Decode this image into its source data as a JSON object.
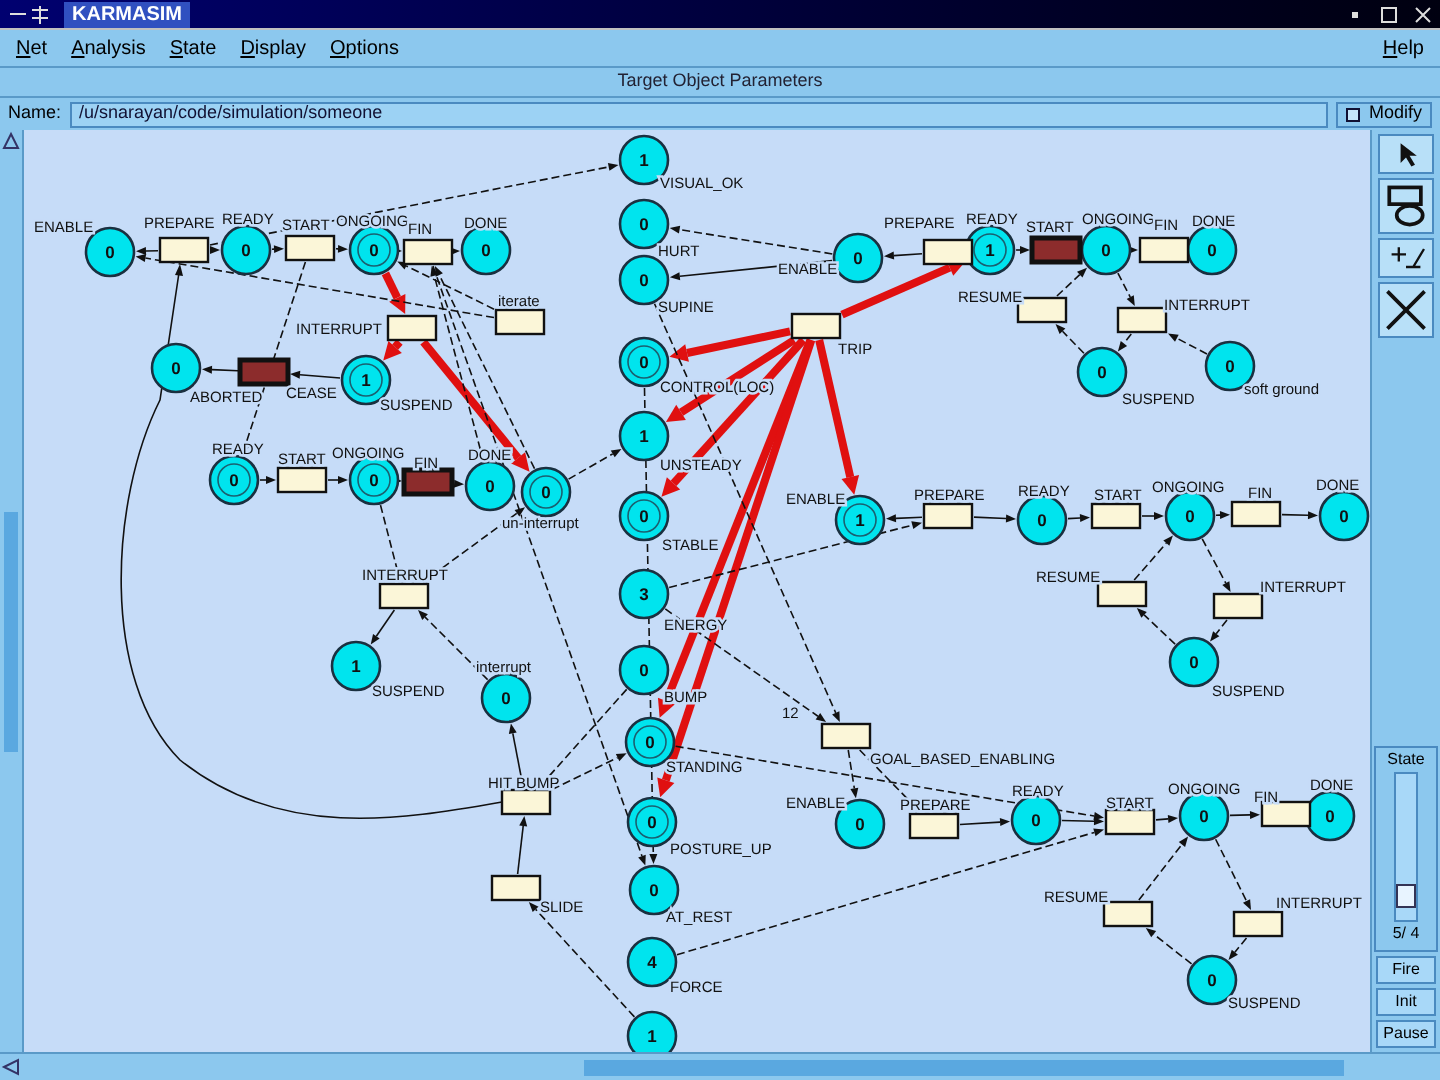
{
  "window": {
    "title": "KARMASIM"
  },
  "menu": [
    "Net",
    "Analysis",
    "State",
    "Display",
    "Options"
  ],
  "help_menu": "Help",
  "section_title": "Target Object Parameters",
  "name_field": {
    "label": "Name:",
    "value": "/u/snarayan/code/simulation/someone"
  },
  "modify": {
    "label": "Modify",
    "checked": false
  },
  "places": [
    {
      "label": "ENABLE",
      "tokens": "0",
      "marked": false
    },
    {
      "label": "READY",
      "tokens": "0",
      "marked": false
    },
    {
      "label": "ONGOING",
      "tokens": "0",
      "marked": true
    },
    {
      "label": "DONE",
      "tokens": "0",
      "marked": false
    },
    {
      "label": "ABORTED",
      "tokens": "0",
      "marked": false
    },
    {
      "label": "SUSPEND",
      "tokens": "1",
      "marked": true
    },
    {
      "label": "READY",
      "tokens": "0",
      "marked": true
    },
    {
      "label": "ONGOING",
      "tokens": "0",
      "marked": true
    },
    {
      "label": "DONE",
      "tokens": "0",
      "marked": false
    },
    {
      "label": "un-interrupt",
      "tokens": "0",
      "marked": true
    },
    {
      "label": "SUSPEND",
      "tokens": "1",
      "marked": false
    },
    {
      "label": "interrupt",
      "tokens": "0",
      "marked": false
    },
    {
      "label": "VISUAL_OK",
      "tokens": "1",
      "marked": false
    },
    {
      "label": "HURT",
      "tokens": "0",
      "marked": false
    },
    {
      "label": "SUPINE",
      "tokens": "0",
      "marked": false
    },
    {
      "label": "CONTROL(LOC)",
      "tokens": "0",
      "marked": true
    },
    {
      "label": "UNSTEADY",
      "tokens": "1",
      "marked": false
    },
    {
      "label": "STABLE",
      "tokens": "0",
      "marked": true
    },
    {
      "label": "ENERGY",
      "tokens": "3",
      "marked": false
    },
    {
      "label": "BUMP",
      "tokens": "0",
      "marked": false
    },
    {
      "label": "STANDING",
      "tokens": "0",
      "marked": true
    },
    {
      "label": "POSTURE_UP",
      "tokens": "0",
      "marked": true
    },
    {
      "label": "AT_REST",
      "tokens": "0",
      "marked": false
    },
    {
      "label": "FORCE",
      "tokens": "4",
      "marked": false
    },
    {
      "tokens": "1",
      "marked": false
    },
    {
      "label": "ENABLE",
      "tokens": "0",
      "marked": false
    },
    {
      "label": "READY",
      "tokens": "1",
      "marked": true
    },
    {
      "label": "ONGOING",
      "tokens": "0",
      "marked": false
    },
    {
      "label": "DONE",
      "tokens": "0",
      "marked": false
    },
    {
      "label": "SUSPEND",
      "tokens": "0",
      "marked": false
    },
    {
      "label": "soft ground",
      "tokens": "0",
      "marked": false
    },
    {
      "label": "ENABLE",
      "tokens": "1",
      "marked": true
    },
    {
      "label": "READY",
      "tokens": "0",
      "marked": false
    },
    {
      "label": "ONGOING",
      "tokens": "0",
      "marked": false
    },
    {
      "label": "DONE",
      "tokens": "0",
      "marked": false
    },
    {
      "label": "SUSPEND",
      "tokens": "0",
      "marked": false
    },
    {
      "label": "ENABLE",
      "tokens": "0",
      "marked": false
    },
    {
      "label": "READY",
      "tokens": "0",
      "marked": false
    },
    {
      "label": "ONGOING",
      "tokens": "0",
      "marked": false
    },
    {
      "label": "DONE",
      "tokens": "0",
      "marked": false
    },
    {
      "label": "SUSPEND",
      "tokens": "0",
      "marked": false
    }
  ],
  "transitions": [
    {
      "label": "PREPARE",
      "fired": false
    },
    {
      "label": "START",
      "fired": false
    },
    {
      "label": "FIN",
      "fired": false
    },
    {
      "label": "INTERRUPT",
      "fired": false
    },
    {
      "label": "iterate",
      "fired": false
    },
    {
      "label": "CEASE",
      "fired": true
    },
    {
      "label": "START",
      "fired": false
    },
    {
      "label": "FIN",
      "fired": true
    },
    {
      "label": "INTERRUPT",
      "fired": false
    },
    {
      "label": "HIT BUMP",
      "fired": false
    },
    {
      "label": "SLIDE",
      "fired": false
    },
    {
      "label": "TRIP",
      "fired": false
    },
    {
      "label": "PREPARE",
      "fired": false
    },
    {
      "label": "START",
      "fired": true
    },
    {
      "label": "FIN",
      "fired": false
    },
    {
      "label": "RESUME",
      "fired": false
    },
    {
      "label": "INTERRUPT",
      "fired": false
    },
    {
      "label": "PREPARE",
      "fired": false
    },
    {
      "label": "START",
      "fired": false
    },
    {
      "label": "FIN",
      "fired": false
    },
    {
      "label": "RESUME",
      "fired": false
    },
    {
      "label": "INTERRUPT",
      "fired": false
    },
    {
      "label": "GOAL_BASED_ENABLING",
      "fired": false
    },
    {
      "label": "PREPARE",
      "fired": false
    },
    {
      "label": "START",
      "fired": false
    },
    {
      "label": "FIN",
      "fired": false
    },
    {
      "label": "RESUME",
      "fired": false
    },
    {
      "label": "INTERRUPT",
      "fired": false
    }
  ],
  "arc_weight": "12",
  "state_panel": {
    "label": "State",
    "level": 0.1,
    "reading": "5/ 4",
    "buttons": [
      "Fire",
      "Init",
      "Pause"
    ]
  }
}
